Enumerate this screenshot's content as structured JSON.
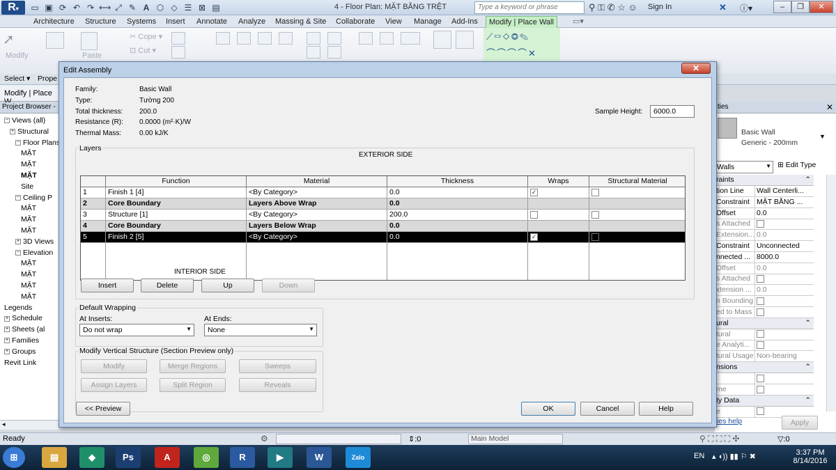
{
  "app": {
    "logo": "R",
    "doc_title": "4 - Floor Plan: MẶT BẰNG TRỆT",
    "search_placeholder": "Type a keyword or phrase",
    "sign_in": "Sign In",
    "window_buttons": [
      "–",
      "❐",
      "✕"
    ]
  },
  "ribbon": {
    "tabs": [
      "Architecture",
      "Structure",
      "Systems",
      "Insert",
      "Annotate",
      "Analyze",
      "Massing & Site",
      "Collaborate",
      "View",
      "Manage",
      "Add-Ins",
      "Modify | Place Wall"
    ],
    "active_tab": "Modify | Place Wall",
    "modify_label": "Modify",
    "paste_label": "Paste",
    "cope_label": "Cope",
    "cut_label": "Cut",
    "select_label": "Select",
    "prope_label": "Prope"
  },
  "left_panel": {
    "modify_bar": "Modify | Place W",
    "header": "Project Browser -",
    "tree": [
      {
        "label": "Views (all)",
        "box": "−"
      },
      {
        "label": "Structural",
        "box": "+"
      },
      {
        "label": "Floor Plans",
        "box": "−"
      },
      {
        "label": "MẶT",
        "box": ""
      },
      {
        "label": "MẶT",
        "box": ""
      },
      {
        "label": "MẶT",
        "box": ""
      },
      {
        "label": "Site",
        "box": ""
      },
      {
        "label": "Ceiling P",
        "box": "−"
      },
      {
        "label": "MẶT",
        "box": ""
      },
      {
        "label": "MẶT",
        "box": ""
      },
      {
        "label": "MẶT",
        "box": ""
      },
      {
        "label": "3D Views",
        "box": "+"
      },
      {
        "label": "Elevation",
        "box": "−"
      },
      {
        "label": "MẶT",
        "box": ""
      },
      {
        "label": "MẶT",
        "box": ""
      },
      {
        "label": "MẶT",
        "box": ""
      },
      {
        "label": "MẶT",
        "box": ""
      },
      {
        "label": "Legends",
        "box": ""
      },
      {
        "label": "Schedule",
        "box": "+"
      },
      {
        "label": "Sheets (al",
        "box": "+"
      },
      {
        "label": "Families",
        "box": "+"
      },
      {
        "label": "Groups",
        "box": "+"
      },
      {
        "label": "Revit Link",
        "box": ""
      }
    ]
  },
  "right_panel": {
    "header": "ties",
    "type_name": "Basic Wall",
    "type_sub": "Generic - 200mm",
    "filter": "Walls",
    "edit_type": "Edit Type",
    "section_constraints": "raints",
    "rows": [
      {
        "label": "tion Line",
        "value": "Wall Centerli...",
        "grey": false
      },
      {
        "label": "Constraint",
        "value": "MẶT BẰNG ...",
        "grey": false
      },
      {
        "label": "Offset",
        "value": "0.0",
        "grey": false
      },
      {
        "label": "s Attached",
        "value": "",
        "grey": true
      },
      {
        "label": "Extension...",
        "value": "0.0",
        "grey": true
      },
      {
        "label": "Constraint",
        "value": "Unconnected",
        "grey": false
      },
      {
        "label": "nnected ...",
        "value": "8000.0",
        "grey": false
      },
      {
        "label": "Offset",
        "value": "0.0",
        "grey": true
      },
      {
        "label": "s Attached",
        "value": "",
        "grey": true
      },
      {
        "label": "xtension ...",
        "value": "0.0",
        "grey": true
      },
      {
        "label": "n Bounding",
        "value": "",
        "grey": true
      },
      {
        "label": "ed to Mass",
        "value": "",
        "grey": true
      }
    ],
    "section_structural": "ural",
    "rows2": [
      {
        "label": "tural",
        "value": "",
        "grey": true
      },
      {
        "label": "e Analyti...",
        "value": "",
        "grey": true
      },
      {
        "label": "tural Usage",
        "value": "Non-bearing",
        "grey": true
      }
    ],
    "section_dimensions": "nsions",
    "rows3": [
      {
        "label": "",
        "value": "",
        "grey": true
      },
      {
        "label": "me",
        "value": "",
        "grey": true
      }
    ],
    "section_identity": "ty Data",
    "rows4": [
      {
        "label": "e",
        "value": "",
        "grey": true
      }
    ],
    "help": "ties help",
    "apply": "Apply"
  },
  "status_bar": {
    "ready": "Ready",
    "zero": ":0",
    "model": "Main Model",
    "filter_count": ":0"
  },
  "taskbar": {
    "lang": "EN",
    "time": "3:37 PM",
    "date": "8/14/2016",
    "icons": [
      {
        "name": "windows-start-icon",
        "glyph": "⊞",
        "color": "#3a7bd5"
      },
      {
        "name": "file-explorer-icon",
        "glyph": "▤",
        "color": "#d9a640"
      },
      {
        "name": "sketchup-icon",
        "glyph": "◆",
        "color": "#1f8f6a"
      },
      {
        "name": "photoshop-icon",
        "glyph": "Ps",
        "color": "#1c3f72"
      },
      {
        "name": "autocad-icon",
        "glyph": "A",
        "color": "#c0241c"
      },
      {
        "name": "app-swirl-icon",
        "glyph": "◎",
        "color": "#5fa83c"
      },
      {
        "name": "revit-icon",
        "glyph": "R",
        "color": "#2c5aa0"
      },
      {
        "name": "3dsmax-icon",
        "glyph": "▶",
        "color": "#227a84"
      },
      {
        "name": "word-icon",
        "glyph": "W",
        "color": "#2b5797"
      },
      {
        "name": "zalo-icon",
        "glyph": "Zalo",
        "color": "#1f8bd6"
      }
    ]
  },
  "dialog": {
    "title": "Edit Assembly",
    "close": "✕",
    "info": [
      {
        "label": "Family:",
        "value": "Basic Wall"
      },
      {
        "label": "Type:",
        "value": "Tường 200"
      },
      {
        "label": "Total thickness:",
        "value": "200.0"
      },
      {
        "label": "Resistance (R):",
        "value": "0.0000 (m²·K)/W"
      },
      {
        "label": "Thermal Mass:",
        "value": "0.00 kJ/K"
      }
    ],
    "sample_height_label": "Sample Height:",
    "sample_height_value": "6000.0",
    "layers_label": "Layers",
    "exterior_side": "EXTERIOR SIDE",
    "interior_side": "INTERIOR SIDE",
    "columns": [
      "",
      "Function",
      "Material",
      "Thickness",
      "Wraps",
      "Structural Material"
    ],
    "rows": [
      {
        "num": "1",
        "function": "Finish 1 [4]",
        "material": "<By Category>",
        "thickness": "0.0",
        "wraps": true,
        "structural": false,
        "kind": "normal"
      },
      {
        "num": "2",
        "function": "Core Boundary",
        "material": "Layers Above Wrap",
        "thickness": "0.0",
        "wraps": null,
        "structural": null,
        "kind": "core"
      },
      {
        "num": "3",
        "function": "Structure [1]",
        "material": "<By Category>",
        "thickness": "200.0",
        "wraps": false,
        "structural": false,
        "kind": "normal"
      },
      {
        "num": "4",
        "function": "Core Boundary",
        "material": "Layers Below Wrap",
        "thickness": "0.0",
        "wraps": null,
        "structural": null,
        "kind": "core"
      },
      {
        "num": "5",
        "function": "Finish 2 [5]",
        "material": "<By Category>",
        "thickness": "0.0",
        "wraps": true,
        "structural": false,
        "kind": "selected"
      }
    ],
    "layer_buttons": {
      "insert": "Insert",
      "delete": "Delete",
      "up": "Up",
      "down": "Down"
    },
    "default_wrapping": "Default Wrapping",
    "at_inserts_label": "At Inserts:",
    "at_inserts_value": "Do not wrap",
    "at_ends_label": "At Ends:",
    "at_ends_value": "None",
    "modify_vertical": "Modify Vertical Structure (Section Preview only)",
    "mv_buttons": {
      "modify": "Modify",
      "merge": "Merge Regions",
      "sweeps": "Sweeps",
      "assign": "Assign Layers",
      "split": "Split Region",
      "reveals": "Reveals"
    },
    "preview": "<< Preview",
    "ok": "OK",
    "cancel": "Cancel",
    "help": "Help"
  }
}
